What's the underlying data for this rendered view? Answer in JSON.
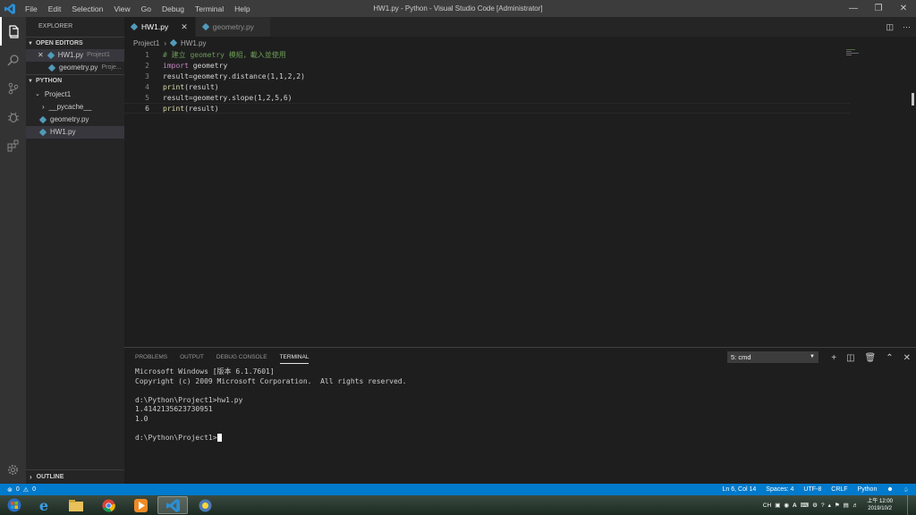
{
  "window": {
    "title": "HW1.py - Python - Visual Studio Code [Administrator]",
    "menu": [
      "File",
      "Edit",
      "Selection",
      "View",
      "Go",
      "Debug",
      "Terminal",
      "Help"
    ]
  },
  "sidebar": {
    "title": "EXPLORER",
    "open_editors_label": "OPEN EDITORS",
    "open_editors": [
      {
        "name": "HW1.py",
        "desc": "Project1"
      },
      {
        "name": "geometry.py",
        "desc": "Proje..."
      }
    ],
    "workspace_label": "PYTHON",
    "folder": "Project1",
    "subfolder": "__pycache__",
    "files": [
      "geometry.py",
      "HW1.py"
    ],
    "outline_label": "OUTLINE"
  },
  "tabs": [
    {
      "label": "HW1.py",
      "active": true
    },
    {
      "label": "geometry.py",
      "active": false
    }
  ],
  "breadcrumb": [
    "Project1",
    "HW1.py"
  ],
  "editor": {
    "lines": [
      {
        "n": "1",
        "text": "# 建立 geometry 模組，載入並使用",
        "type": "comment"
      },
      {
        "n": "2",
        "kw": "import",
        "rest": " geometry"
      },
      {
        "n": "3",
        "text": "result=geometry.distance(1,1,2,2)"
      },
      {
        "n": "4",
        "fn": "print",
        "rest": "(result)"
      },
      {
        "n": "5",
        "text": "result=geometry.slope(1,2,5,6)"
      },
      {
        "n": "6",
        "fn": "print",
        "rest": "(result)"
      }
    ]
  },
  "panel": {
    "tabs": [
      "PROBLEMS",
      "OUTPUT",
      "DEBUG CONSOLE",
      "TERMINAL"
    ],
    "terminal_select": "5: cmd",
    "terminal_lines": [
      "Microsoft Windows [版本 6.1.7601]",
      "Copyright (c) 2009 Microsoft Corporation.  All rights reserved.",
      "",
      "d:\\Python\\Project1>hw1.py",
      "1.4142135623730951",
      "1.0",
      ""
    ],
    "prompt": "d:\\Python\\Project1>"
  },
  "statusbar": {
    "errors": "0",
    "warnings": "0",
    "position": "Ln 6, Col 14",
    "spaces": "Spaces: 4",
    "encoding": "UTF-8",
    "eol": "CRLF",
    "language": "Python"
  },
  "taskbar": {
    "tray_lang": "CH",
    "clock_time": "上午 12:00",
    "clock_date": "2019/10/2"
  },
  "colors": {
    "accent": "#007acc",
    "comment": "#6a9955",
    "keyword": "#c586c0",
    "function": "#dcdcaa",
    "python_icon": "#519aba"
  }
}
